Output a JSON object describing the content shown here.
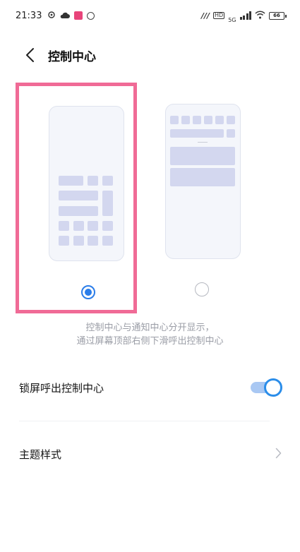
{
  "status_bar": {
    "time": "21:33",
    "left_icons": [
      "location-icon",
      "cloud-icon",
      "app-badge-icon",
      "sync-ring-icon"
    ],
    "network_label": "HD",
    "network_gen": "5G",
    "right_icons": [
      "wifi-icon",
      "battery-icon"
    ],
    "battery_level": "66"
  },
  "header": {
    "title": "控制中心"
  },
  "options": [
    {
      "id": "separate",
      "selected": true
    },
    {
      "id": "combined",
      "selected": false
    }
  ],
  "description": {
    "line1": "控制中心与通知中心分开显示，",
    "line2": "通过屏幕顶部右侧下滑呼出控制中心"
  },
  "settings": {
    "lock_screen_label": "锁屏呼出控制中心",
    "lock_screen_enabled": true,
    "theme_label": "主题样式"
  },
  "colors": {
    "accent": "#2b7de9",
    "highlight_border": "#f06b96",
    "tile": "#d3d7ef",
    "hint_text": "#9a9da6"
  }
}
